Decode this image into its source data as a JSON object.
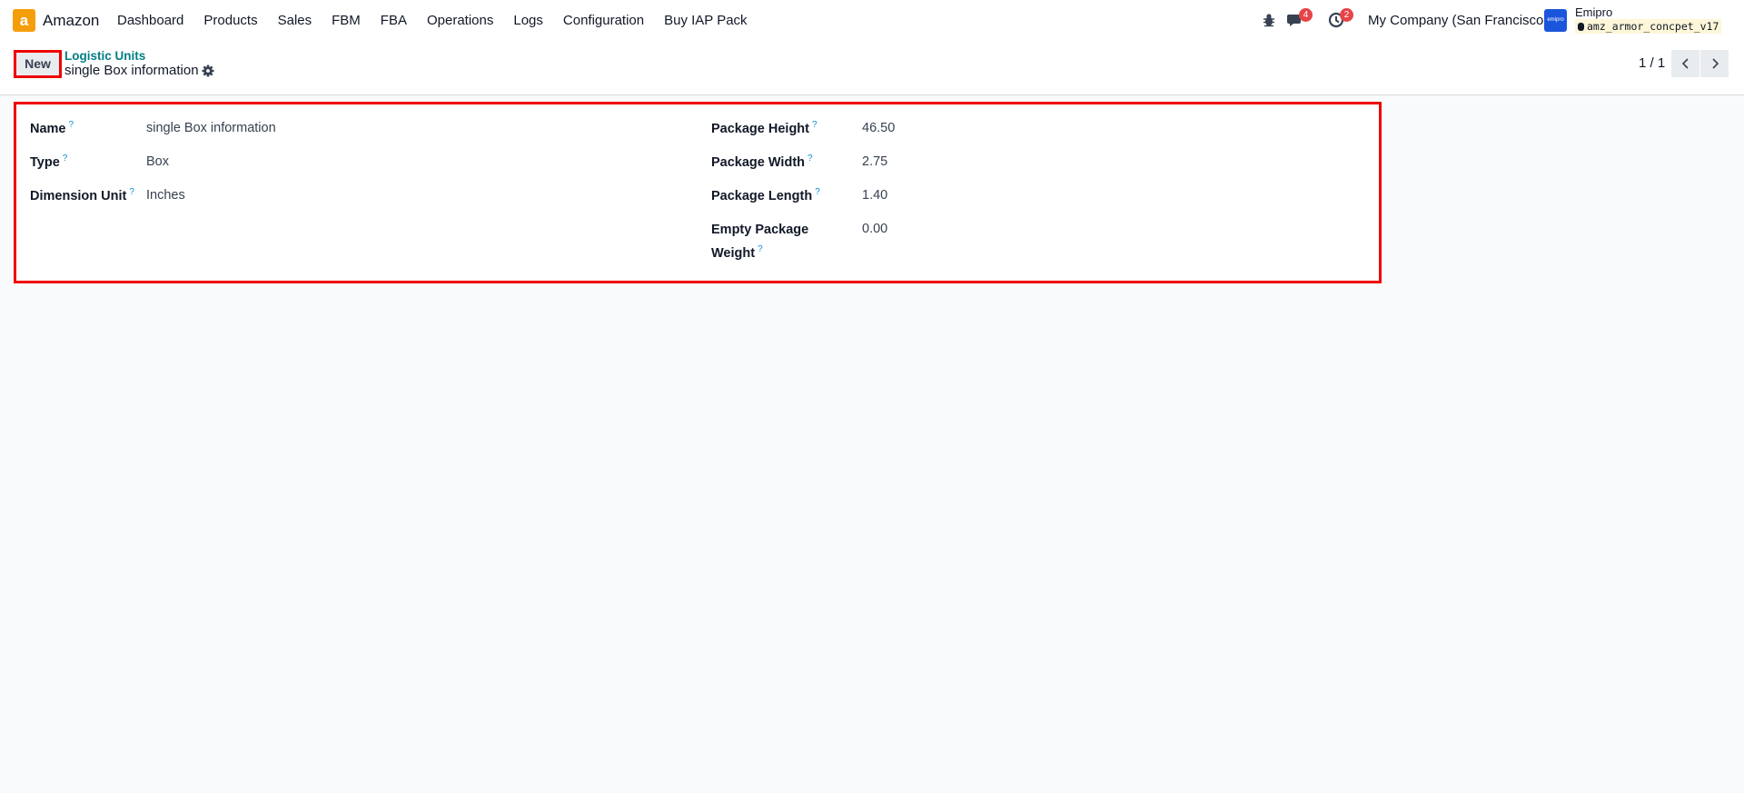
{
  "navbar": {
    "app_name": "Amazon",
    "app_logo_letter": "a",
    "menu": [
      "Dashboard",
      "Products",
      "Sales",
      "FBM",
      "FBA",
      "Operations",
      "Logs",
      "Configuration",
      "Buy IAP Pack"
    ],
    "messages_count": "4",
    "activities_count": "2",
    "company": "My Company (San Francisco)",
    "user_avatar_text": "emipro",
    "user_name": "Emipro",
    "database": "amz_armor_concpet_v17"
  },
  "control_panel": {
    "new_label": "New",
    "breadcrumb_parent": "Logistic Units",
    "record_title": "single Box information",
    "pager": "1 / 1"
  },
  "form": {
    "help_mark": "?",
    "left": [
      {
        "label": "Name",
        "value": "single Box information"
      },
      {
        "label": "Type",
        "value": "Box"
      },
      {
        "label": "Dimension Unit",
        "value": "Inches"
      }
    ],
    "right": [
      {
        "label": "Package Height",
        "value": "46.50"
      },
      {
        "label": "Package Width",
        "value": "2.75"
      },
      {
        "label": "Package Length",
        "value": "1.40"
      },
      {
        "label_line1": "Empty Package",
        "label_line2": "Weight",
        "value": "0.00"
      }
    ]
  },
  "colors": {
    "accent": "#017e84",
    "highlight_border": "#ee0000",
    "badge": "#e64448",
    "amazon_orange": "#f59e0b"
  }
}
